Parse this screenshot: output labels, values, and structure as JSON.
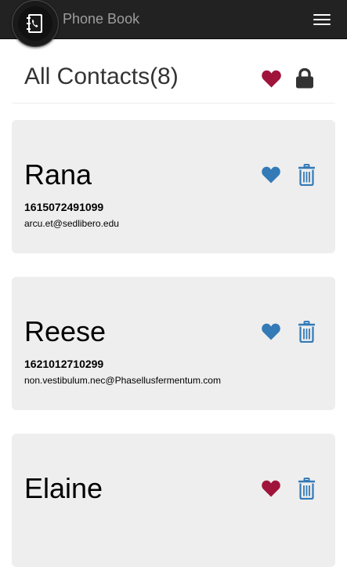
{
  "colors": {
    "navbar_bg": "#222222",
    "brand_text": "#9d9d9d",
    "favorite": "#a0143c",
    "not_favorite": "#337ab7",
    "lock": "#333333",
    "card_bg": "#eeeeee"
  },
  "navbar": {
    "logo_icon": "address-book-icon",
    "brand": "Phone Book",
    "toggle_icon": "hamburger-menu-icon"
  },
  "header": {
    "title": "All Contacts(8)",
    "favorites_icon": "heart-icon",
    "lock_icon": "lock-icon"
  },
  "contacts": [
    {
      "name": "Rana",
      "phone": "1615072491099",
      "email": "arcu.et@sedlibero.edu",
      "favorite": false
    },
    {
      "name": "Reese",
      "phone": "1621012710299",
      "email": "non.vestibulum.nec@Phasellusfermentum.com",
      "favorite": false
    },
    {
      "name": "Elaine",
      "phone": "",
      "email": "",
      "favorite": true
    }
  ]
}
